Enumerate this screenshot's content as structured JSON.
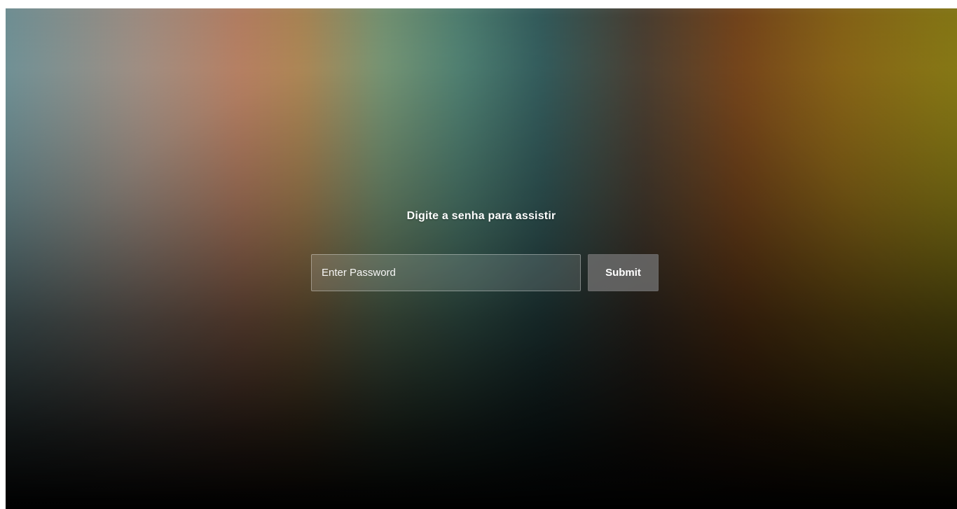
{
  "password_gate": {
    "title": "Digite a senha para assistir",
    "input": {
      "value": "",
      "placeholder": "Enter Password"
    },
    "submit_label": "Submit"
  }
}
